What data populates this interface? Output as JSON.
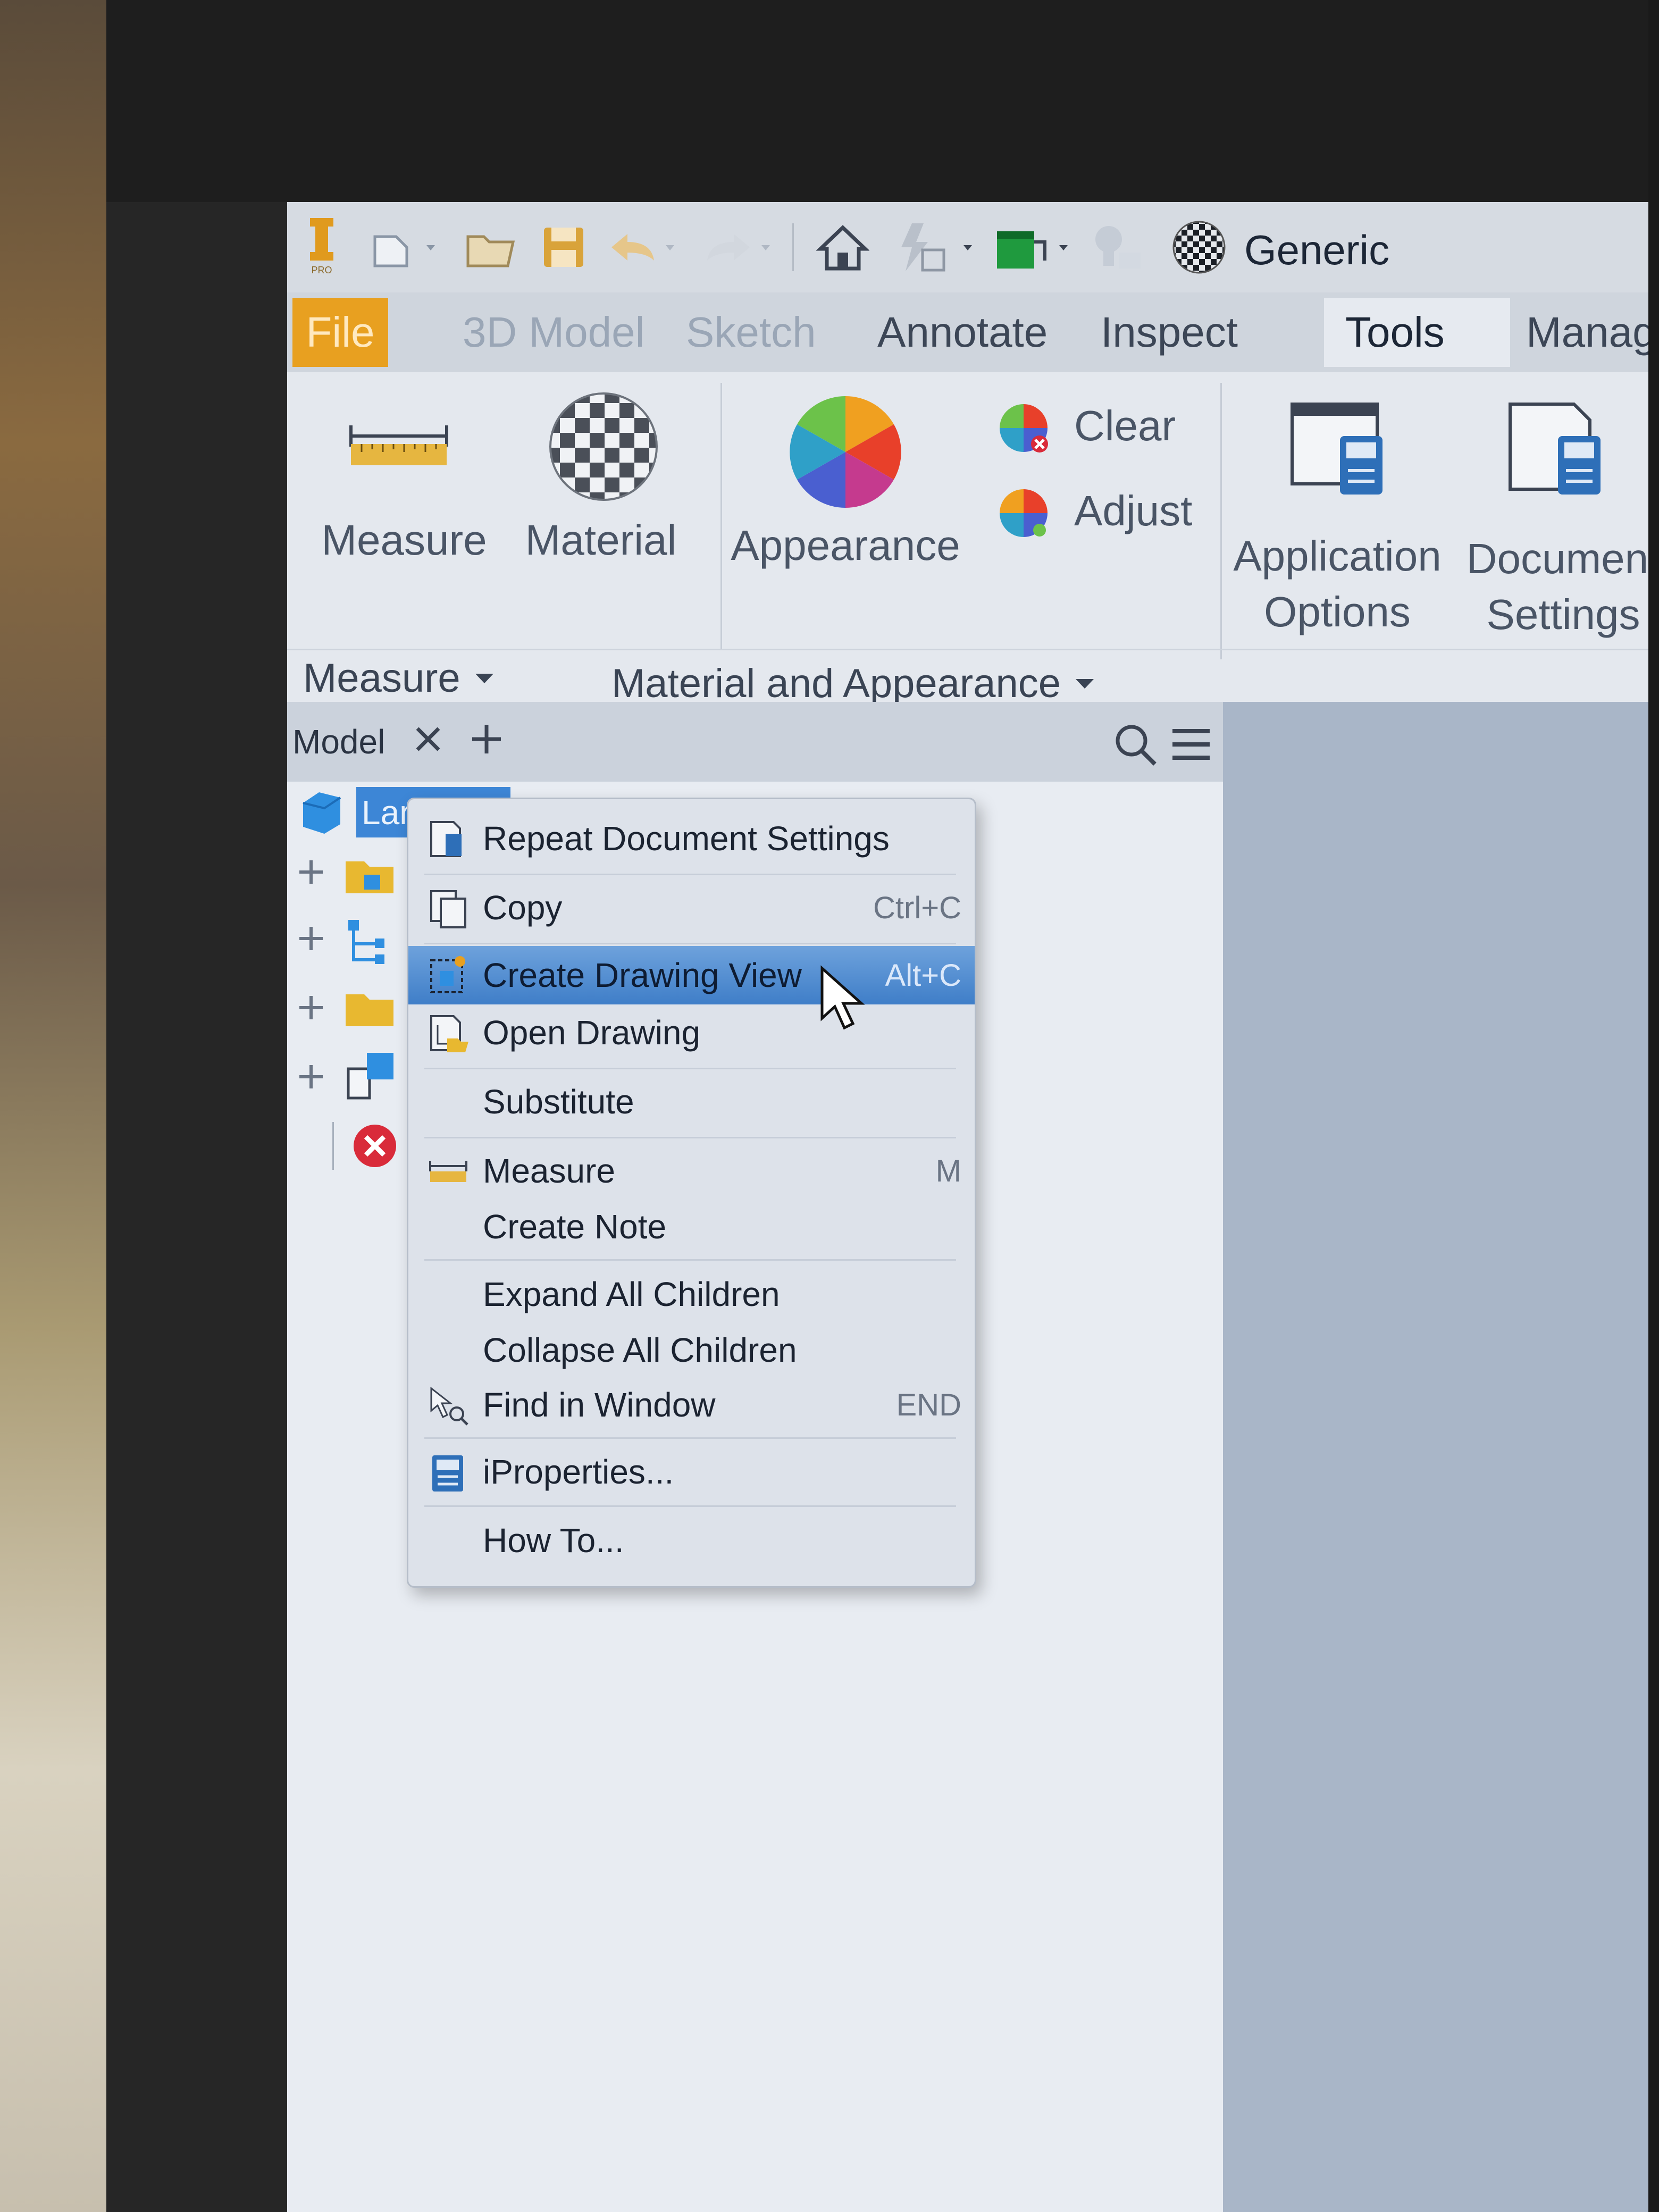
{
  "quick_access": {
    "app_logo": "inventor-pro-logo",
    "icons": [
      "new-icon",
      "open-icon",
      "save-icon",
      "undo-icon",
      "redo-icon",
      "home-icon",
      "update-icon",
      "project-icon",
      "material-icon"
    ],
    "material_value": "Generic"
  },
  "tabs": [
    {
      "label": "File",
      "state": "file"
    },
    {
      "label": "3D Model",
      "state": "disabled"
    },
    {
      "label": "Sketch",
      "state": "disabled"
    },
    {
      "label": "Annotate",
      "state": "normal"
    },
    {
      "label": "Inspect",
      "state": "normal"
    },
    {
      "label": "Tools",
      "state": "active"
    },
    {
      "label": "Manage",
      "state": "normal"
    }
  ],
  "ribbon": {
    "measure": "Measure",
    "material": "Material",
    "appearance": "Appearance",
    "clear": "Clear",
    "adjust": "Adjust",
    "application_options_line1": "Application",
    "application_options_line2": "Options",
    "document_settings_line1": "Document",
    "document_settings_line2": "Settings",
    "group_measure": "Measure",
    "group_material": "Material and Appearance"
  },
  "browser": {
    "tab_label": "Model",
    "root_label": "Lar"
  },
  "context_menu": {
    "items": [
      {
        "label": "Repeat Document Settings",
        "shortcut": ""
      },
      {
        "label": "Copy",
        "shortcut": "Ctrl+C"
      },
      {
        "label": "Create Drawing View",
        "shortcut": "Alt+C"
      },
      {
        "label": "Open Drawing",
        "shortcut": ""
      },
      {
        "label": "Substitute",
        "shortcut": ""
      },
      {
        "label": "Measure",
        "shortcut": "M"
      },
      {
        "label": "Create Note",
        "shortcut": ""
      },
      {
        "label": "Expand All Children",
        "shortcut": ""
      },
      {
        "label": "Collapse All Children",
        "shortcut": ""
      },
      {
        "label": "Find in Window",
        "shortcut": "END"
      },
      {
        "label": "iProperties...",
        "shortcut": ""
      },
      {
        "label": "How To...",
        "shortcut": ""
      }
    ]
  },
  "colors": {
    "file_tab": "#e8a020",
    "highlight": "#4f8ad0",
    "selection": "#3d86d6"
  }
}
